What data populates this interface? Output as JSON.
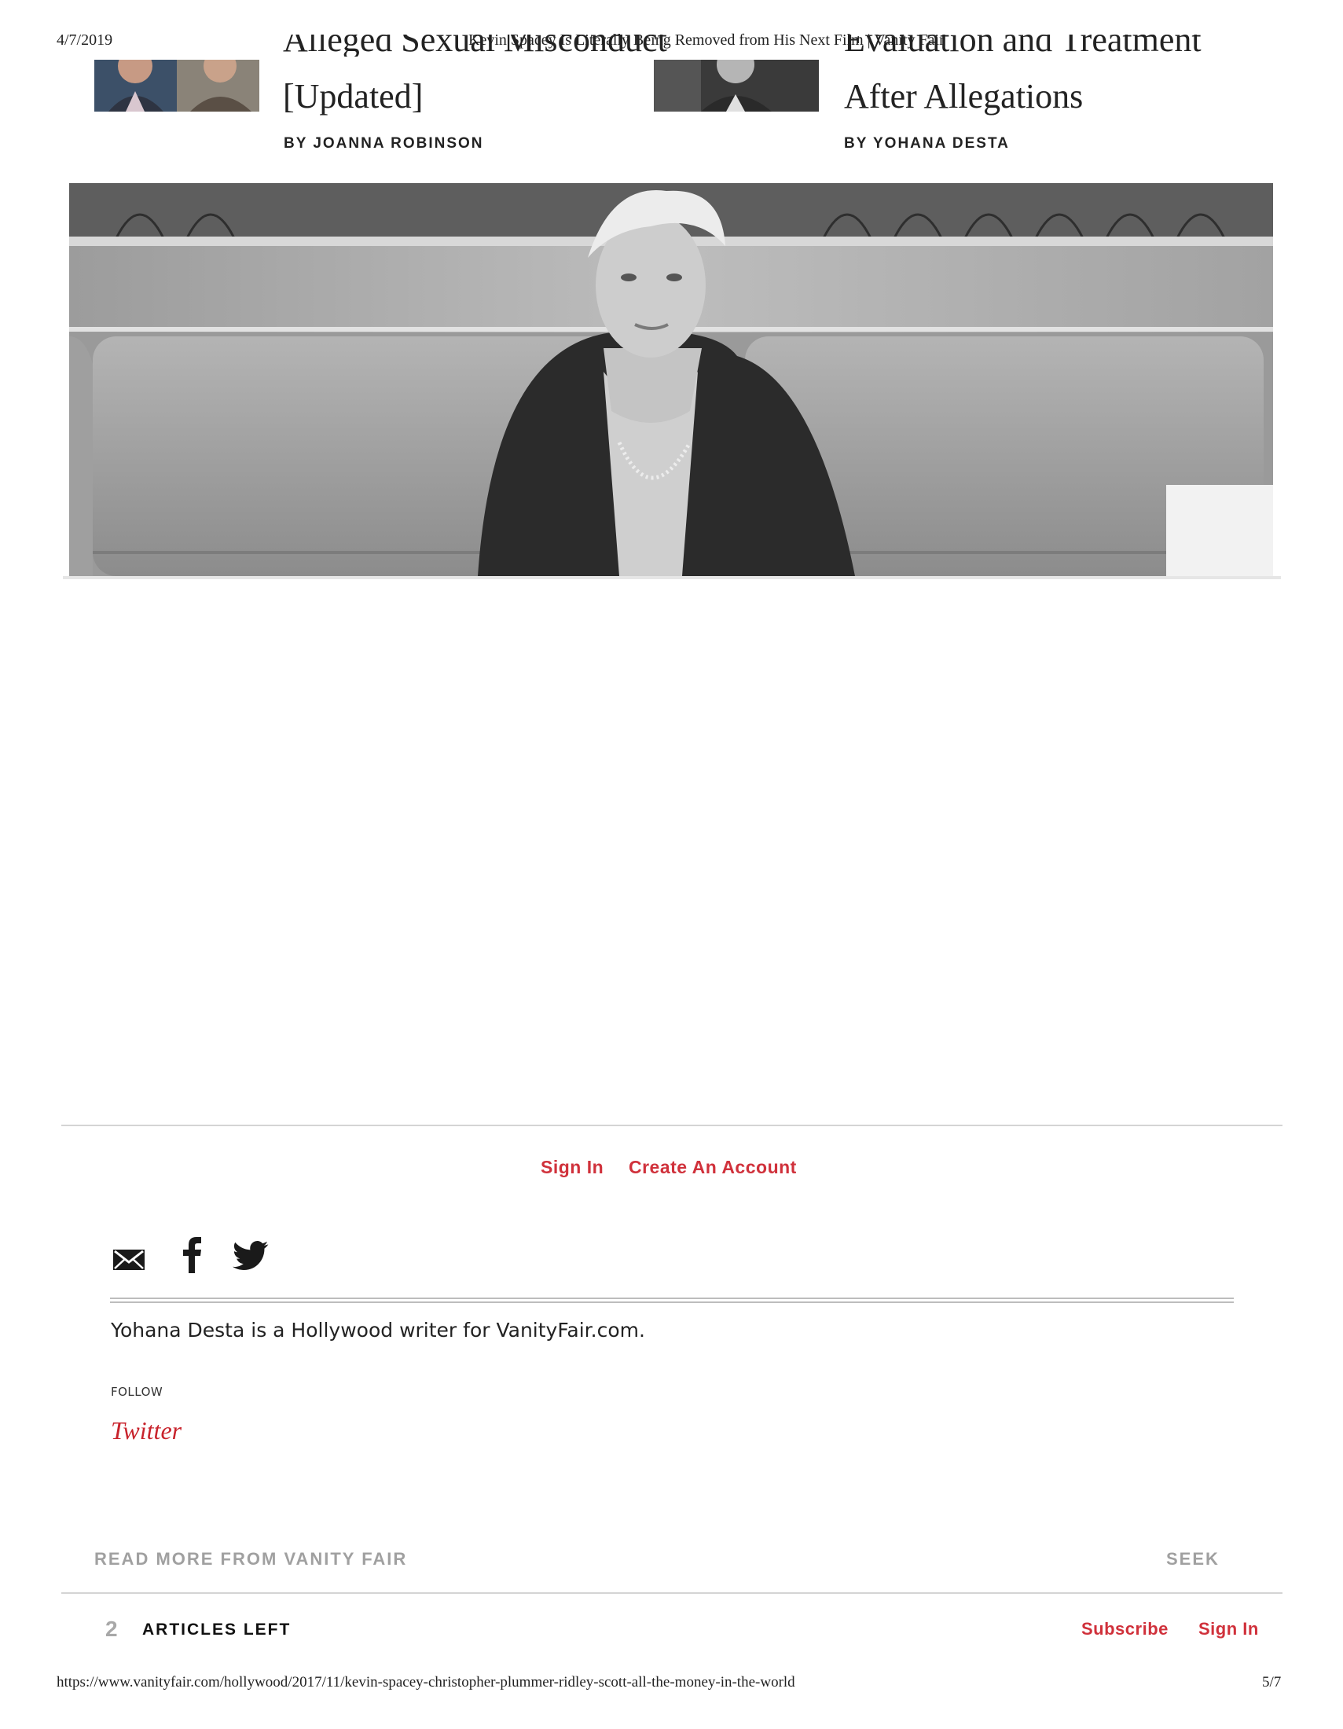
{
  "print_header": {
    "date": "4/7/2019",
    "title": "Kevin Spacey Is Literally Being Removed from His Next Film | Vanity Fair"
  },
  "related": [
    {
      "headline_partial": "Alleged Sexual Misconduct",
      "headline_line2": "[Updated]",
      "byline": "BY JOANNA ROBINSON"
    },
    {
      "headline_partial": "Evaluation and Treatment",
      "headline_line2": "After Allegations",
      "byline": "BY YOHANA DESTA"
    }
  ],
  "account": {
    "sign_in": "Sign In",
    "create_account": "Create An Account"
  },
  "share": {
    "icons": [
      "email-icon",
      "facebook-icon",
      "twitter-icon"
    ]
  },
  "author": {
    "bio": "Yohana Desta is a Hollywood writer for VanityFair.com.",
    "follow_label": "FOLLOW",
    "twitter_label": "Twitter"
  },
  "bottom": {
    "read_more": "READ MORE FROM VANITY FAIR",
    "seek": "SEEK",
    "articles_count": "2",
    "articles_left": "ARTICLES LEFT",
    "subscribe": "Subscribe",
    "sign_in": "Sign In"
  },
  "print_footer": {
    "url": "https://www.vanityfair.com/hollywood/2017/11/kevin-spacey-christopher-plummer-ridley-scott-all-the-money-in-the-world",
    "page": "5/7"
  },
  "colors": {
    "accent_red": "#d0313b",
    "twitter_red": "#c8232c",
    "muted_gray": "#a0a0a0"
  }
}
